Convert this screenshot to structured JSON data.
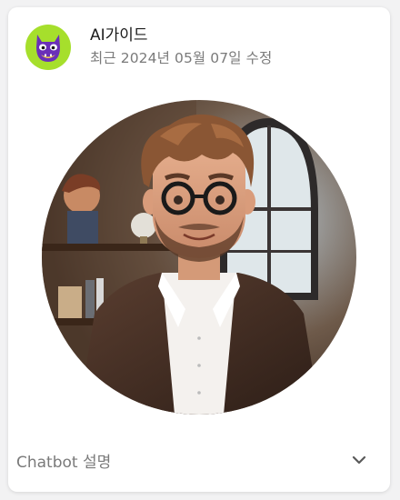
{
  "bot": {
    "name": "AI가이드",
    "updated": "최근 2024년 05월 07일 수정",
    "avatar_icon": "purple-monster-icon",
    "avatar_bg": "#a6df2c"
  },
  "profile_image": {
    "icon": "3d-cartoon-man-portrait"
  },
  "description_toggle": {
    "label": "Chatbot 설명",
    "icon": "chevron-down-icon",
    "expanded": false
  }
}
